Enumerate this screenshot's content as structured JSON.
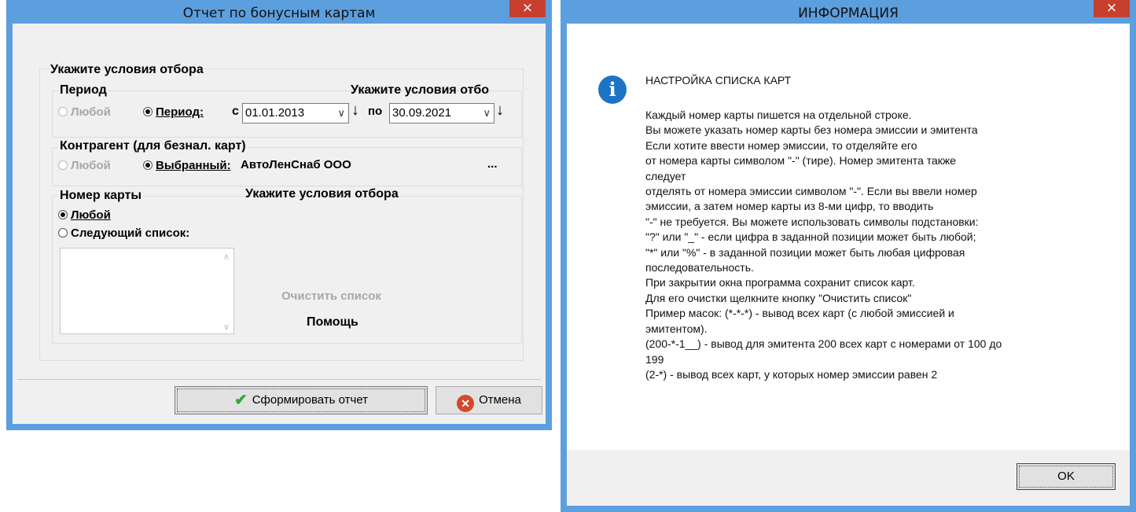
{
  "left_window": {
    "title": "Отчет по бонусным картам",
    "close_glyph": "×",
    "group_title": "Укажите условия отбора",
    "period": {
      "label": "Период",
      "overlay_text": "Укажите условия отбо",
      "any_label": "Любой",
      "period_label": "Период:",
      "from_label": "с",
      "from_value": "01.01.2013",
      "to_label": "по",
      "to_value": "30.09.2021"
    },
    "contractor": {
      "label": "Контрагент (для безнал. карт)",
      "any_label": "Любой",
      "selected_label": "Выбранный:",
      "selected_value": "АвтоЛенСнаб ООО",
      "browse_label": "..."
    },
    "card": {
      "label": "Номер карты",
      "overlay_text": "Укажите условия отбора",
      "any_label": "Любой",
      "list_label": "Следующий список:",
      "list_text": "",
      "clear_label": "Очистить список",
      "help_label": "Помощь"
    },
    "buttons": {
      "ok_label": "Сформировать отчет",
      "cancel_label": "Отмена"
    }
  },
  "right_window": {
    "title": "ИНФОРМАЦИЯ",
    "close_glyph": "×",
    "heading": "НАСТРОЙКА СПИСКА КАРТ",
    "lines": [
      "Каждый номер карты пишется на отдельной строке.",
      "Вы можете указать номер карты без номера эмиссии и эмитента",
      "Если хотите ввести номер эмиссии, то отделяйте его",
      "от номера карты символом \"-\" (тире). Номер эмитента также",
      "следует",
      "отделять от номера эмиссии символом \"-\". Если вы ввели номер",
      "эмиссии, а затем номер карты из 8-ми цифр, то вводить",
      "\"-\" не требуется. Вы можете использовать символы подстановки:",
      "\"?\" или \"_\" - если цифра в заданной позиции может быть любой;",
      "\"*\" или \"%\" - в заданной позиции может быть любая цифровая",
      "последовательность.",
      "При закрытии окна программа сохранит список карт.",
      "Для его очистки щелкните кнопку \"Очистить список\"",
      "Пример масок: (*-*-*) - вывод всех карт (с любой эмиссией и",
      "эмитентом).",
      "(200-*-1__) - вывод для эмитента 200 всех карт с номерами от 100 до",
      "199",
      "(2-*) - вывод всех карт, у которых номер эмиссии равен 2"
    ],
    "ok_label": "OK"
  },
  "colors": {
    "title_bar": "#5c9fdf",
    "close_button": "#c7402e",
    "client_bg": "#f0f0f0",
    "info_icon": "#1d74c4",
    "check_green": "#3aa53a",
    "cancel_red": "#d24a2c"
  },
  "icons": [
    "close-icon",
    "dropdown-arrow-icon",
    "down-arrow-icon",
    "checkmark-icon",
    "cancel-icon",
    "info-icon"
  ]
}
